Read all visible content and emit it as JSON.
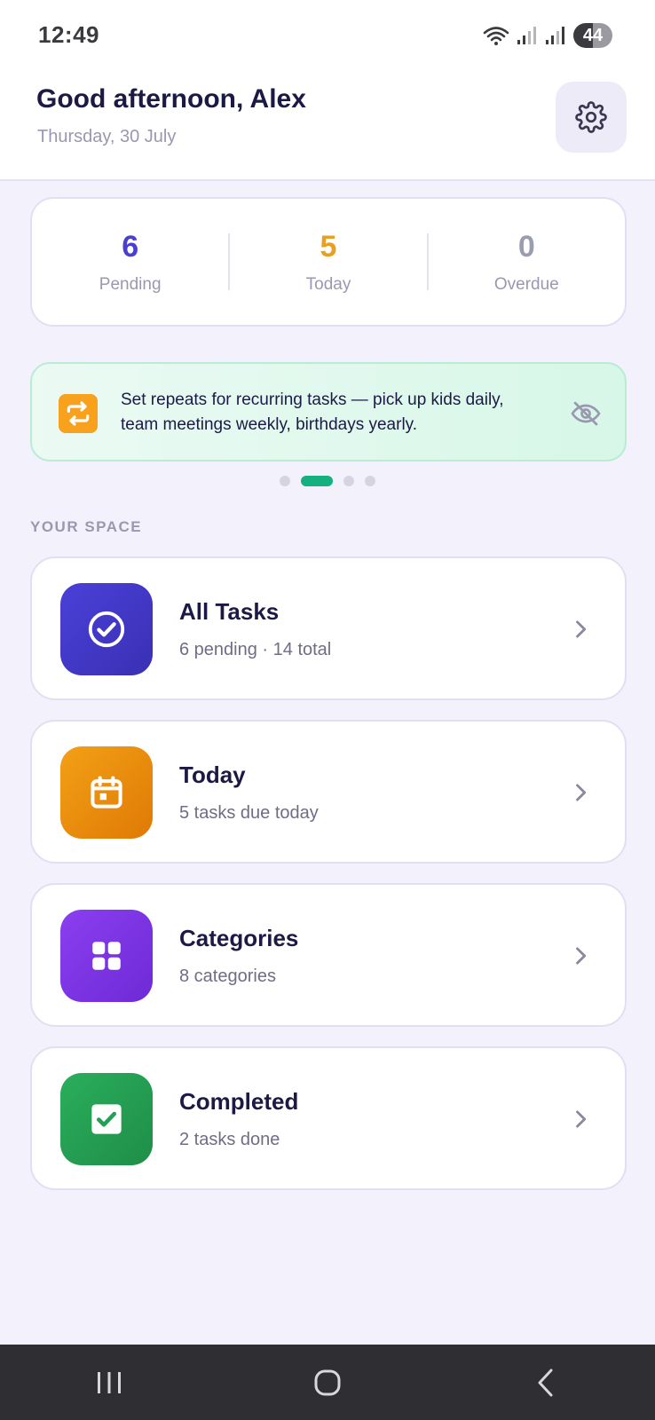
{
  "status_bar": {
    "time": "12:49",
    "battery": "44"
  },
  "header": {
    "greeting": "Good afternoon, Alex",
    "date": "Thursday, 30 July"
  },
  "stats": [
    {
      "value": "6",
      "label": "Pending",
      "color": "#4a3fcf"
    },
    {
      "value": "5",
      "label": "Today",
      "color": "#e8a024"
    },
    {
      "value": "0",
      "label": "Overdue",
      "color": "#9a9db0"
    }
  ],
  "tip": {
    "text": "Set repeats for recurring tasks — pick up kids daily, team meetings weekly, birthdays yearly.",
    "icon": "repeat-icon",
    "pager_count": 4,
    "pager_active": 2
  },
  "section_title": "YOUR SPACE",
  "nav_items": [
    {
      "title": "All Tasks",
      "subtitle": "6 pending · 14 total",
      "icon": "check-circle-icon",
      "color": "#4238c8"
    },
    {
      "title": "Today",
      "subtitle": "5 tasks due today",
      "icon": "calendar-icon",
      "color": "#ee8c0c"
    },
    {
      "title": "Categories",
      "subtitle": "8 categories",
      "icon": "grid-icon",
      "color": "#7f35e4"
    },
    {
      "title": "Completed",
      "subtitle": "2 tasks done",
      "icon": "checkbox-icon",
      "color": "#22a055"
    }
  ],
  "colors": {
    "background": "#f3f2fc",
    "text_primary": "#1c1a45",
    "text_muted": "#9a98b0",
    "accent_green": "#14b07f"
  }
}
